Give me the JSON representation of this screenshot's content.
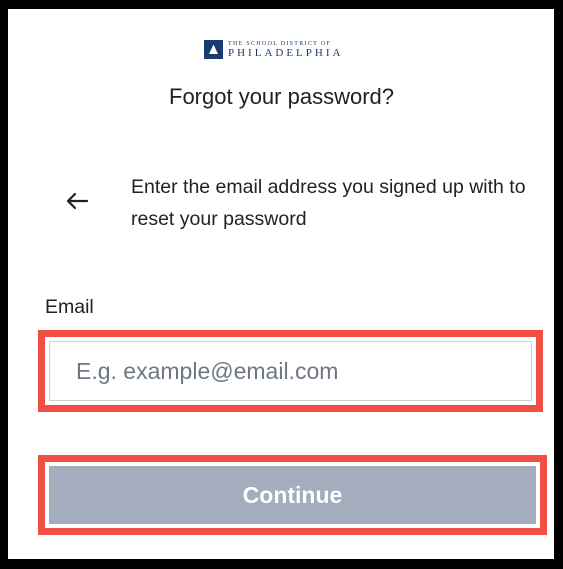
{
  "header": {
    "logo_small_text": "The School District of",
    "logo_big_text": "PHILADELPHIA",
    "title": "Forgot your password?"
  },
  "instructions": "Enter the email address you signed up with to reset your password",
  "back_icon": "arrow-left-icon",
  "form": {
    "email_label": "Email",
    "email_value": "",
    "email_placeholder": "E.g. example@email.com",
    "continue_label": "Continue"
  },
  "colors": {
    "highlight": "#f04f43",
    "button_disabled": "#a3adbd",
    "brand": "#1c3c6e"
  }
}
